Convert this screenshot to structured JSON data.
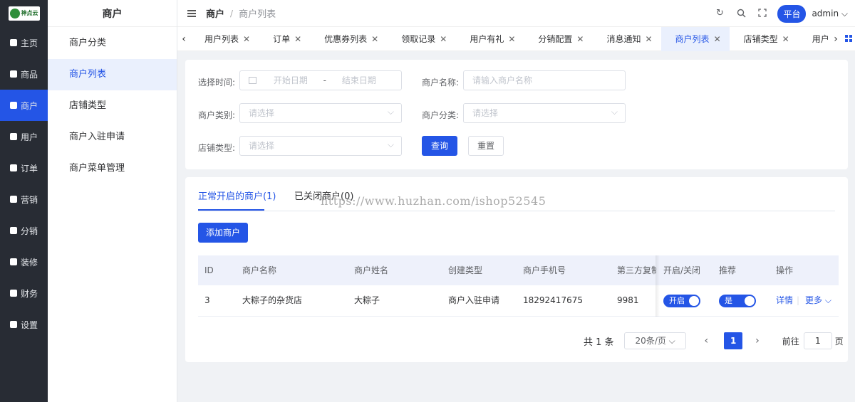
{
  "logo": {
    "text": "神点云"
  },
  "nav": [
    {
      "label": "主页",
      "icon": "grid-icon"
    },
    {
      "label": "商品",
      "icon": "bag-icon"
    },
    {
      "label": "商户",
      "icon": "store-icon",
      "active": true
    },
    {
      "label": "用户",
      "icon": "user-icon"
    },
    {
      "label": "订单",
      "icon": "order-icon"
    },
    {
      "label": "营销",
      "icon": "chart-icon"
    },
    {
      "label": "分销",
      "icon": "share-icon"
    },
    {
      "label": "装修",
      "icon": "home-icon"
    },
    {
      "label": "财务",
      "icon": "finance-icon"
    },
    {
      "label": "设置",
      "icon": "gear-icon"
    }
  ],
  "submenu": {
    "title": "商户",
    "items": [
      "商户分类",
      "商户列表",
      "店铺类型",
      "商户入驻申请",
      "商户菜单管理"
    ]
  },
  "breadcrumb": {
    "parent": "商户",
    "sep": "/",
    "current": "商户列表"
  },
  "topright": {
    "platform": "平台",
    "user": "admin"
  },
  "tabs": [
    "用户列表",
    "订单",
    "优惠券列表",
    "领取记录",
    "用户有礼",
    "分销配置",
    "消息通知",
    "商户列表",
    "店铺类型",
    "用户标签"
  ],
  "filter": {
    "time_label": "选择时间:",
    "start_ph": "开始日期",
    "dash": "-",
    "end_ph": "结束日期",
    "name_label": "商户名称:",
    "name_ph": "请输入商户名称",
    "type_label": "商户类别:",
    "type_ph": "请选择",
    "cat_label": "商户分类:",
    "cat_ph": "请选择",
    "store_label": "店铺类型:",
    "store_ph": "请选择",
    "query": "查询",
    "reset": "重置"
  },
  "list": {
    "tab_open": "正常开启的商户(1)",
    "tab_closed": "已关闭商户(0)",
    "watermark": "https://www.huzhan.com/ishop52545",
    "add": "添加商户",
    "headers": [
      "ID",
      "商户名称",
      "商户姓名",
      "创建类型",
      "商户手机号",
      "第三方复制次",
      "开启/关闭",
      "推荐",
      "操作"
    ],
    "rows": [
      {
        "id": "3",
        "name": "大粽子的杂货店",
        "person": "大粽子",
        "type": "商户入驻申请",
        "phone": "18292417675",
        "copies": "9981",
        "open": "开启",
        "recommend": "是",
        "detail": "详情",
        "sep": "|",
        "more": "更多 ⌵"
      }
    ]
  },
  "pager": {
    "total": "共 1 条",
    "size": "20条/页 ⌵",
    "page": "1",
    "goto": "前往",
    "goto_val": "1",
    "page_unit": "页"
  }
}
